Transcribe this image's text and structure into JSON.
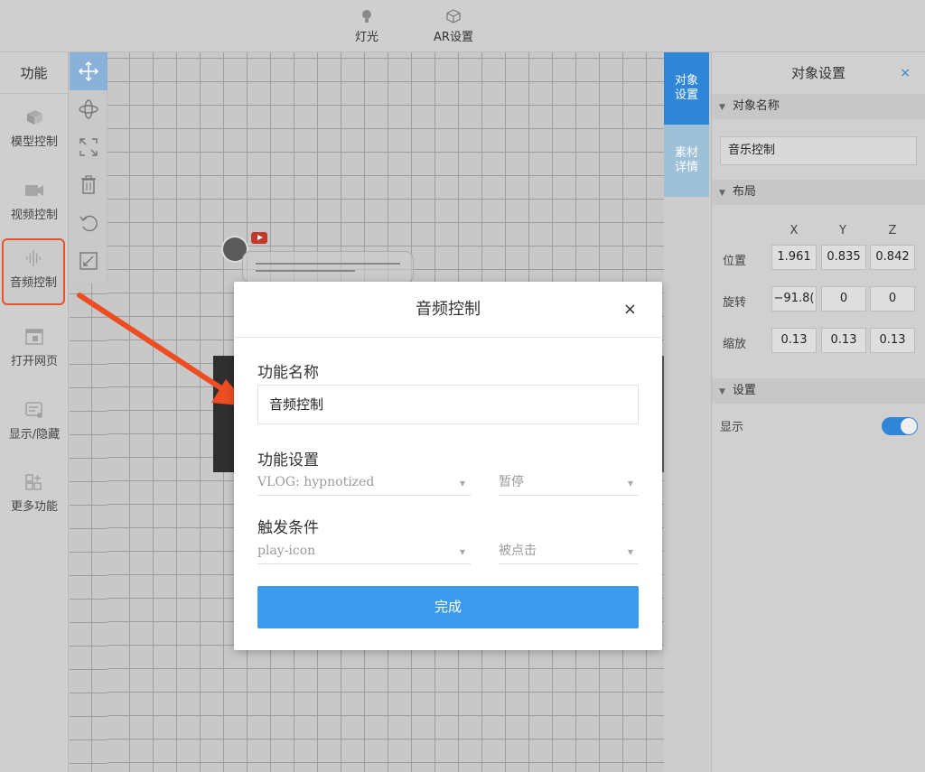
{
  "topbar": {
    "light_label": "灯光",
    "ar_label": "AR设置"
  },
  "left_panel": {
    "title": "功能",
    "items": [
      {
        "label": "模型控制",
        "icon": "cube-icon"
      },
      {
        "label": "视频控制",
        "icon": "video-camera-icon"
      },
      {
        "label": "音频控制",
        "icon": "audio-wave-icon"
      },
      {
        "label": "打开网页",
        "icon": "browser-window-icon"
      },
      {
        "label": "显示/隐藏",
        "icon": "visibility-icon"
      },
      {
        "label": "更多功能",
        "icon": "grid-plus-icon"
      }
    ]
  },
  "toolbar": {
    "tools": [
      "move-icon",
      "rotate-icon",
      "scale-icon",
      "trash-icon",
      "undo-icon",
      "fit-icon"
    ]
  },
  "right_tabs": {
    "object_settings": "对象设置",
    "material_details": "素材详情"
  },
  "right_panel": {
    "title": "对象设置",
    "close": "×",
    "section_name": "对象名称",
    "object_name": "音乐控制",
    "section_layout": "布局",
    "axes": [
      "X",
      "Y",
      "Z"
    ],
    "position_label": "位置",
    "position": [
      "1.961",
      "0.835",
      "0.842"
    ],
    "rotation_label": "旋转",
    "rotation": [
      "−91.8(",
      "0",
      "0"
    ],
    "scale_label": "缩放",
    "scale": [
      "0.13",
      "0.13",
      "0.13"
    ],
    "section_settings": "设置",
    "show_label": "显示",
    "show_enabled": true
  },
  "modal": {
    "title": "音频控制",
    "close": "×",
    "name_label": "功能名称",
    "name_value": "音频控制",
    "settings_label": "功能设置",
    "audio_select": "VLOG: hypnotized",
    "action_select": "暂停",
    "trigger_label": "触发条件",
    "target_select": "play-icon",
    "event_select": "被点击",
    "done_button": "完成"
  },
  "colors": {
    "accent": "#3b99ee",
    "tab_active": "#2f86d6",
    "highlight_border": "#e8532b"
  }
}
